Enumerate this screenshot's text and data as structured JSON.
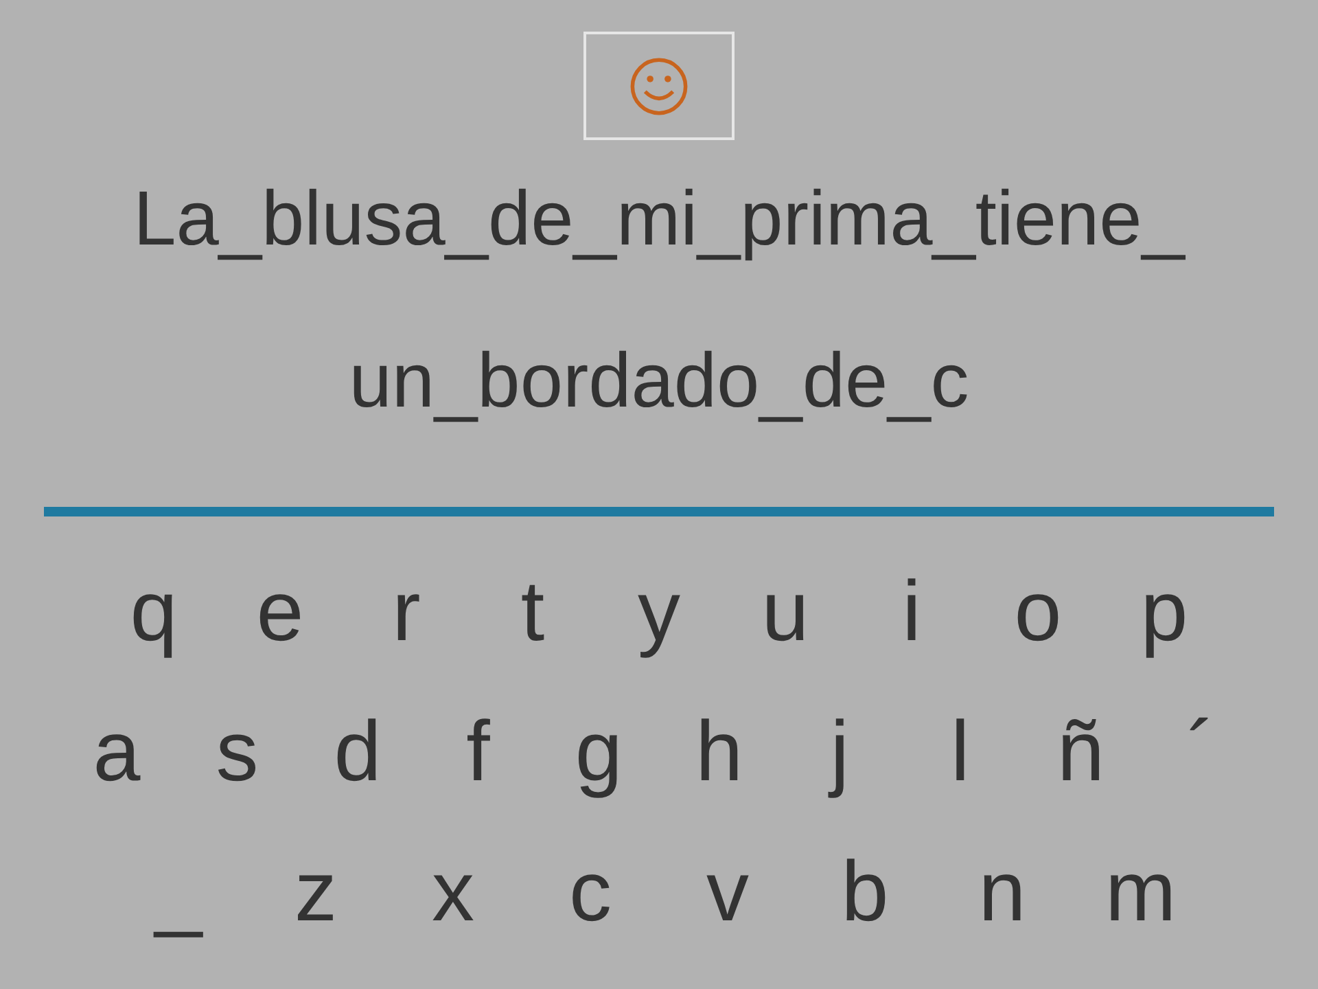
{
  "sentence_lines": [
    "La_blusa_de_mi_prima_tiene_",
    "un_bordado_de_c"
  ],
  "keyboard": {
    "rows": [
      [
        "q",
        "e",
        "r",
        "t",
        "y",
        "u",
        "i",
        "o",
        "p"
      ],
      [
        "a",
        "s",
        "d",
        "f",
        "g",
        "h",
        "j",
        "l",
        "ñ",
        "´"
      ],
      [
        "_",
        "z",
        "x",
        "c",
        "v",
        "b",
        "n",
        "m"
      ]
    ]
  }
}
